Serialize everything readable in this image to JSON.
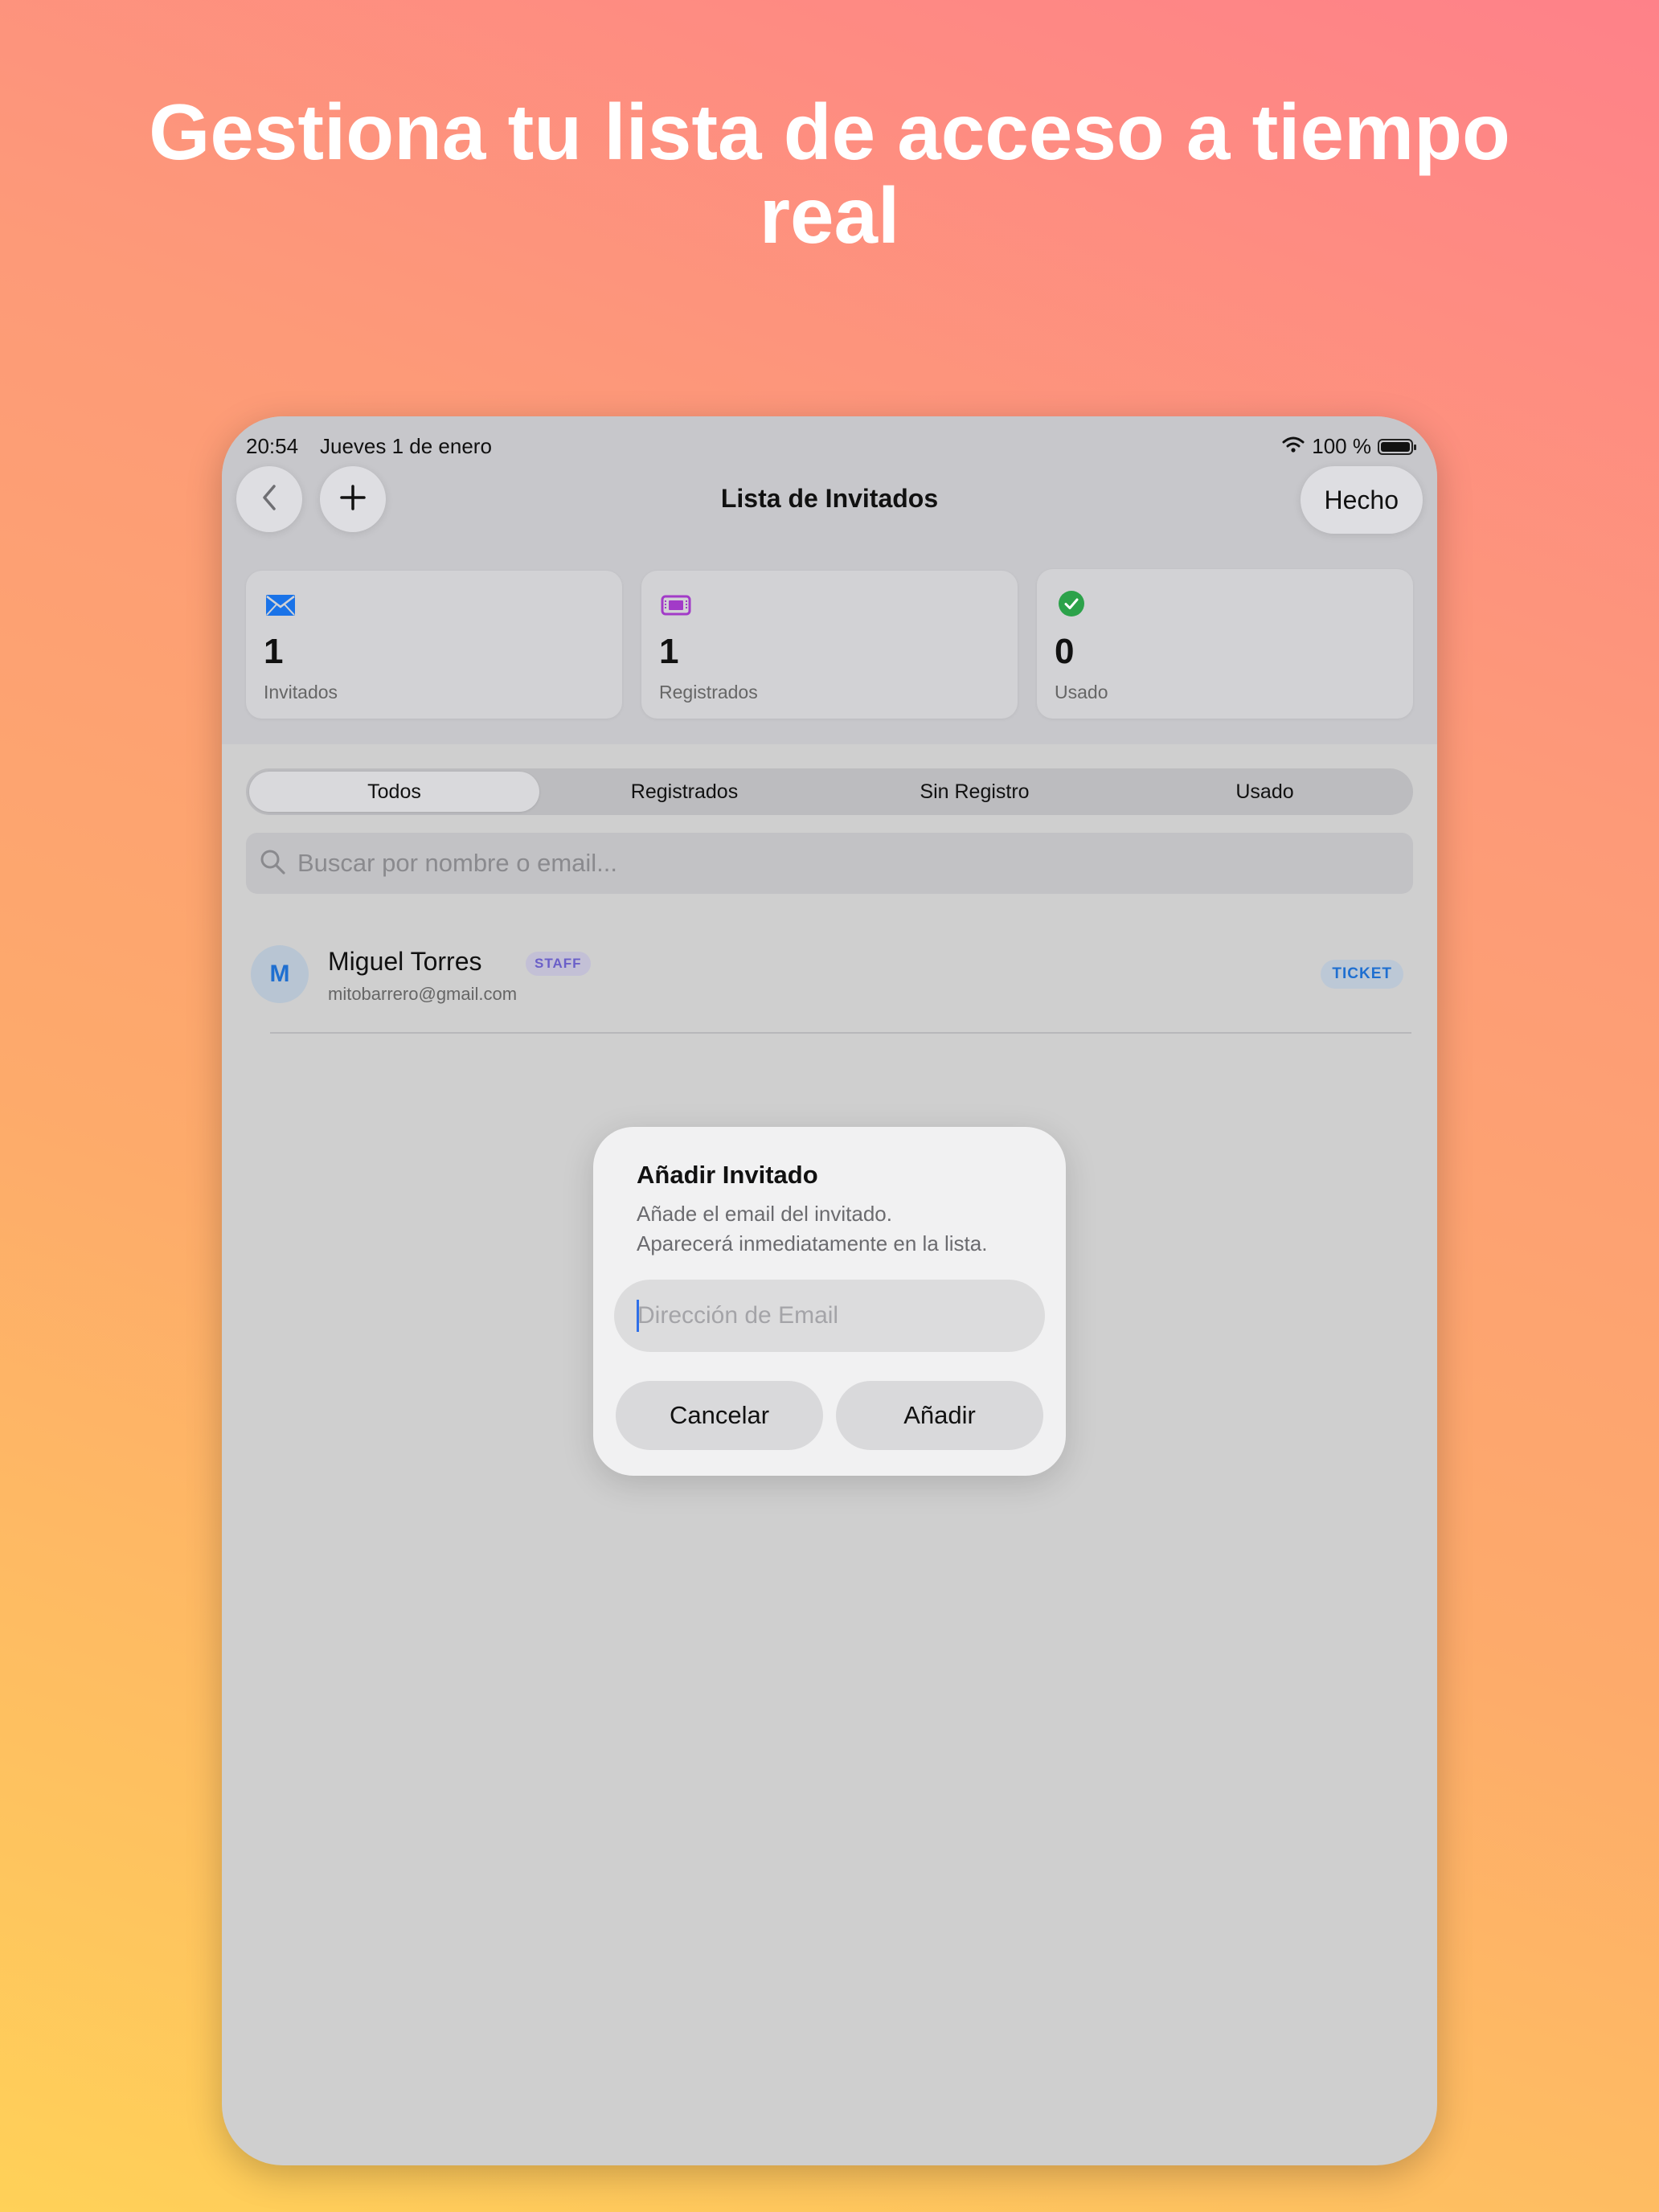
{
  "headline": {
    "line1": "Gestiona tu lista de acceso a tiempo",
    "line2": "real"
  },
  "status_bar": {
    "time": "20:54",
    "date": "Jueves 1 de enero",
    "battery": "100 %",
    "battery_level": 1.0
  },
  "nav": {
    "title": "Lista de Invitados",
    "done_label": "Hecho",
    "back_icon": "chevron-left-icon",
    "add_icon": "plus-icon"
  },
  "stats": [
    {
      "icon": "envelope-icon",
      "icon_color": "#1a73e8",
      "value": "1",
      "label": "Invitados"
    },
    {
      "icon": "ticket-icon",
      "icon_color": "#a23bc8",
      "value": "1",
      "label": "Registrados"
    },
    {
      "icon": "checkmark-circle-icon",
      "icon_color": "#2ca24a",
      "value": "0",
      "label": "Usado"
    }
  ],
  "filters": {
    "tabs": [
      "Todos",
      "Registrados",
      "Sin Registro",
      "Usado"
    ],
    "selected": "Todos"
  },
  "search": {
    "placeholder": "Buscar por nombre o email..."
  },
  "guests": [
    {
      "initial": "M",
      "name": "Miguel Torres",
      "role_badge": "STAFF",
      "email": "mitobarrero@gmail.com",
      "status_badge": "TICKET"
    }
  ],
  "dialog": {
    "title": "Añadir Invitado",
    "message_line1": "Añade el email del invitado.",
    "message_line2": "Aparecerá inmediatamente en la lista.",
    "input_placeholder": "Dirección de Email",
    "cancel_label": "Cancelar",
    "confirm_label": "Añadir"
  },
  "colors": {
    "accent_blue": "#1f6fd0",
    "staff_purple": "#6a5fc8",
    "caret_blue": "#2f6fe8"
  }
}
